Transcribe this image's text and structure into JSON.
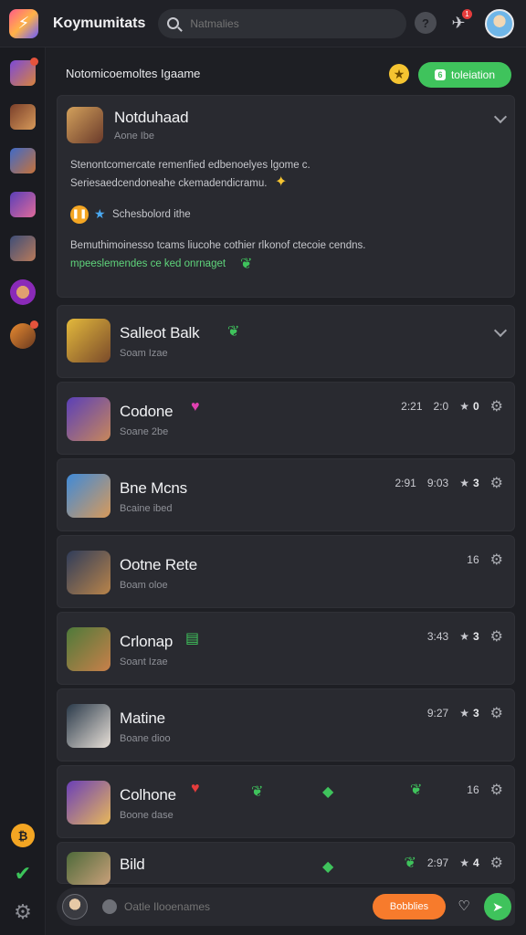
{
  "topbar": {
    "app_title": "Koymumitats",
    "search_placeholder": "Natmalies",
    "notif_count": "1"
  },
  "colors": {
    "accent_green": "#3fc35c",
    "accent_orange": "#f77b2c",
    "star": "#f5c431"
  },
  "header": {
    "title": "Notomicoemoltes Igaame",
    "action_label": "toleiation"
  },
  "featured": {
    "name": "Notduhaad",
    "sub": "Aone Ibe",
    "desc_lines": [
      "Stenontcomercate remenfied edbenoelyes lgome c.",
      "Seriesaedcendoneahe ckemadendicramu."
    ],
    "tag_label": "Schesbolord ithe",
    "text_lines": [
      "Bemuthimoinesso tcams liucohe cothier rlkonof ctecoie cendns."
    ],
    "link_text": "mpeeslemendes ce ked onrnaget"
  },
  "games": [
    {
      "name": "Salleot Balk",
      "sub": "Soam Izae",
      "stats": [],
      "star_value": "",
      "icon": "chevron-down-icon"
    },
    {
      "name": "Codone",
      "sub": "Soane 2be",
      "stats": [
        "2:21",
        "2:0"
      ],
      "star_value": "0"
    },
    {
      "name": "Bne Mcns",
      "sub": "Bcaine ibed",
      "stats": [
        "2:91",
        "9:03"
      ],
      "star_value": "3"
    },
    {
      "name": "Ootne Rete",
      "sub": "Boam oloe",
      "stats": [
        "16"
      ],
      "star_value": ""
    },
    {
      "name": "Crlonap",
      "sub": "Soant Izae",
      "stats": [
        "3:43"
      ],
      "star_value": "3"
    },
    {
      "name": "Matine",
      "sub": "Boane dioo",
      "stats": [
        "9:27"
      ],
      "star_value": "3"
    },
    {
      "name": "Colhone",
      "sub": "Boone dase",
      "stats": [
        "16"
      ],
      "star_value": ""
    },
    {
      "name": "Bild",
      "sub": "",
      "stats": [
        "2:97"
      ],
      "star_value": "4"
    }
  ],
  "bottombar": {
    "compose_placeholder": "Oatle Ilooenames",
    "orange_label": "Bobblies"
  }
}
